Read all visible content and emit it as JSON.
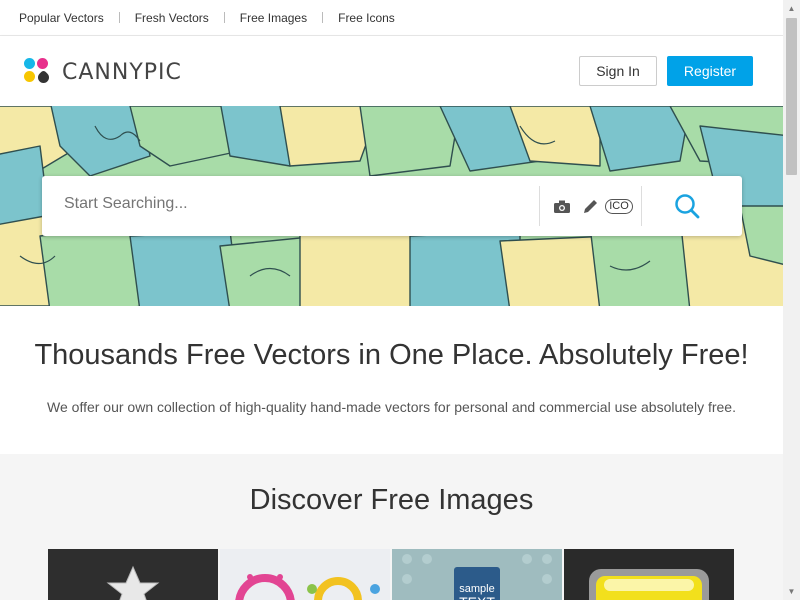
{
  "topnav": {
    "items": [
      "Popular Vectors",
      "Fresh Vectors",
      "Free Images",
      "Free Icons"
    ]
  },
  "brand": {
    "name": "CANNYPIC",
    "colors": {
      "cyan": "#16b7e8",
      "magenta": "#e8308c",
      "yellow": "#f7c600",
      "black": "#333333"
    }
  },
  "header": {
    "signin_label": "Sign In",
    "register_label": "Register",
    "register_color": "#00a2e8"
  },
  "search": {
    "placeholder": "Start Searching...",
    "tools": [
      "camera-icon",
      "pencil-icon",
      "ico-icon"
    ],
    "ico_label": "ICO",
    "search_icon_color": "#1aa3e0"
  },
  "tagline": {
    "title": "Thousands Free Vectors in One Place. Absolutely Free!",
    "subtitle": "We offer our own collection of high-quality hand-made vectors for personal and commercial use absolutely free."
  },
  "discover": {
    "title": "Discover Free Images",
    "thumbs": [
      {
        "name": "silver-star-badge"
      },
      {
        "name": "colorful-frames"
      },
      {
        "name": "sample-text-label",
        "text": "sample\nTEXT"
      },
      {
        "name": "yellow-glossy-button"
      }
    ]
  }
}
